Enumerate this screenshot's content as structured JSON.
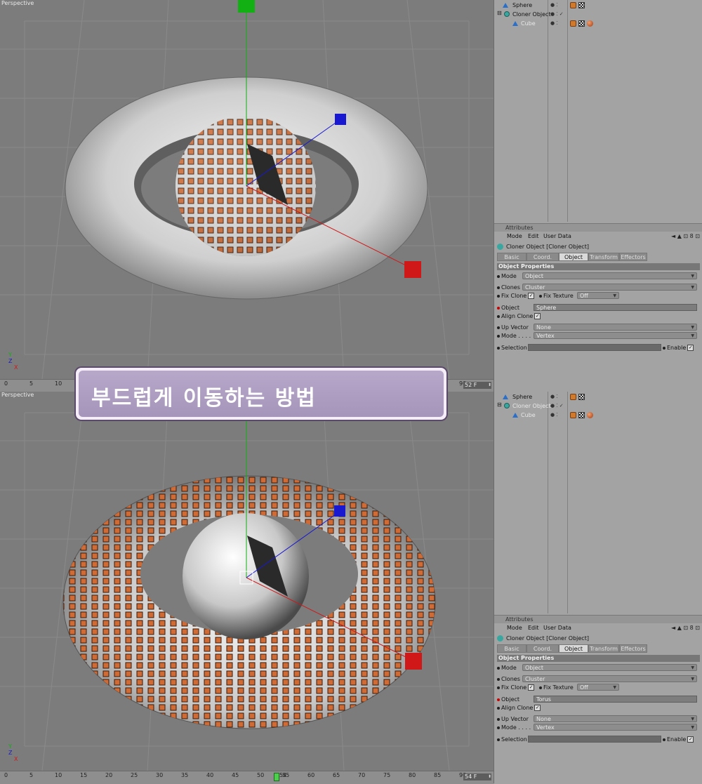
{
  "colors": {
    "viewport_bg": "#7c7c7c",
    "panel_bg": "#a3a3a3",
    "clone_orange": "#d06b35",
    "axis_x": "#d01818",
    "axis_y": "#13b013",
    "axis_z": "#1818d0"
  },
  "timeline": {
    "ticks": [
      "0",
      "5",
      "10",
      "15",
      "20",
      "25",
      "30",
      "35",
      "40",
      "45",
      "50",
      "55",
      "60",
      "65",
      "70",
      "75",
      "80",
      "85",
      "90"
    ],
    "current_frame": "54",
    "end_frame_field": "52 F",
    "end_frame_field_bottom": "54 F"
  },
  "panels": [
    {
      "viewport_label": "Perspective",
      "axis_labels": {
        "y": "Y",
        "z": "Z",
        "x": "X"
      },
      "objects": [
        {
          "name": "Sphere",
          "dim": false
        },
        {
          "name": "Cloner Object",
          "dim": false
        },
        {
          "name": "Cube",
          "dim": true
        }
      ],
      "attributes": {
        "header": "Attributes",
        "menu": [
          "Mode",
          "Edit",
          "User Data"
        ],
        "nav": "◄  ▲  ⊡ 8 ⊡",
        "title": "Cloner Object [Cloner Object]",
        "tabs": [
          "Basic",
          "Coord.",
          "Object",
          "Transform",
          "Effectors"
        ],
        "active_tab": "Object",
        "section": "Object Properties",
        "mode_label": "Mode",
        "mode_value": "Object",
        "clones_label": "Clones",
        "clones_value": "Cluster",
        "fix_clone_label": "Fix Clone",
        "fix_texture_label": "Fix Texture",
        "fix_texture_value": "Off",
        "object_label": "Object",
        "object_value": "Sphere",
        "align_clone_label": "Align Clone",
        "up_vector_label": "Up Vector",
        "up_vector_value": "None",
        "mode2_label": "Mode . . . .",
        "mode2_value": "Vertex",
        "selection_label": "Selection",
        "enable_label": "Enable"
      }
    },
    {
      "viewport_label": "Perspective",
      "axis_labels": {
        "y": "Y",
        "z": "Z",
        "x": "X"
      },
      "objects": [
        {
          "name": "Sphere",
          "dim": false
        },
        {
          "name": "Cloner Object",
          "dim": true
        },
        {
          "name": "Cube",
          "dim": true
        }
      ],
      "attributes": {
        "header": "Attributes",
        "menu": [
          "Mode",
          "Edit",
          "User Data"
        ],
        "nav": "◄  ▲  ⊡ 8 ⊡",
        "title": "Cloner Object [Cloner Object]",
        "tabs": [
          "Basic",
          "Coord.",
          "Object",
          "Transform",
          "Effectors"
        ],
        "active_tab": "Object",
        "section": "Object Properties",
        "mode_label": "Mode",
        "mode_value": "Object",
        "clones_label": "Clones",
        "clones_value": "Cluster",
        "fix_clone_label": "Fix Clone",
        "fix_texture_label": "Fix Texture",
        "fix_texture_value": "Off",
        "object_label": "Object",
        "object_value": "Torus",
        "align_clone_label": "Align Clone",
        "up_vector_label": "Up Vector",
        "up_vector_value": "None",
        "mode2_label": "Mode . . . .",
        "mode2_value": "Vertex",
        "selection_label": "Selection",
        "enable_label": "Enable"
      }
    }
  ],
  "banner": {
    "text": "부드럽게 이동하는 방법"
  }
}
